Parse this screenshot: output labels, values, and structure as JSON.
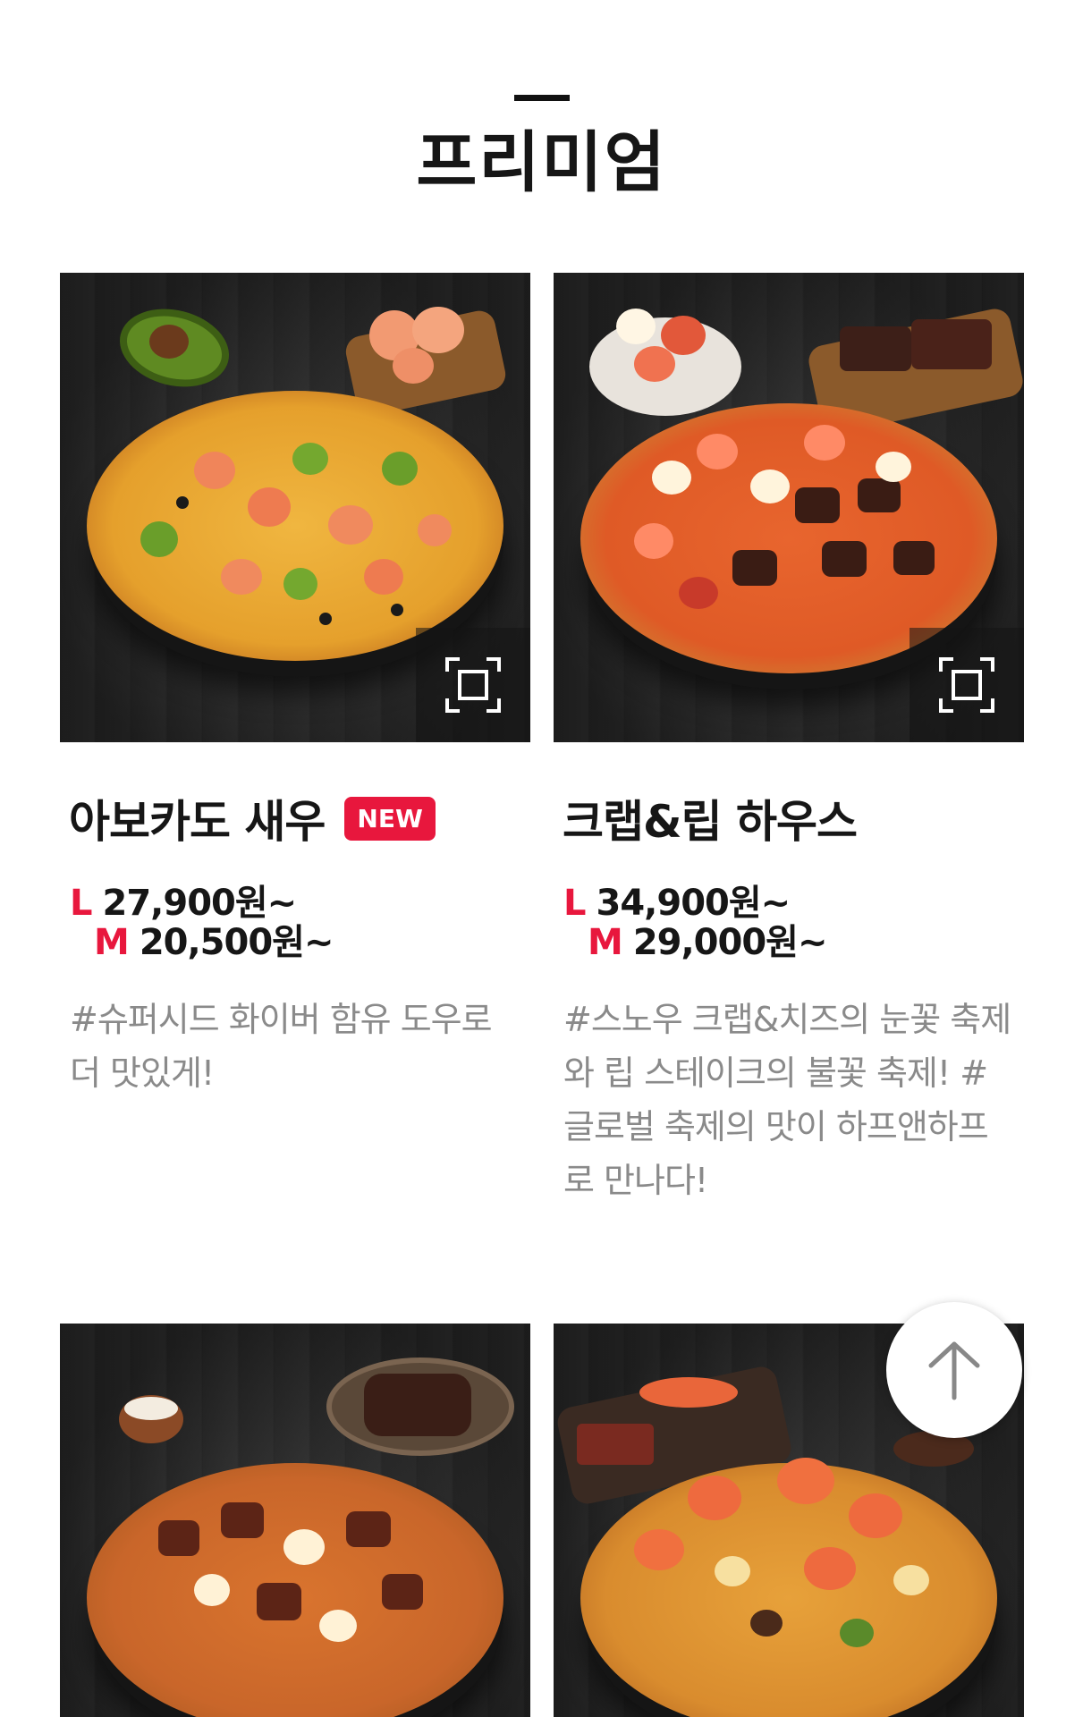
{
  "section": {
    "title": "프리미엄"
  },
  "products": [
    {
      "name": "아보카도 새우",
      "badge": "NEW",
      "price_l_size": "L",
      "price_l": "27,900원~",
      "price_m_size": "M",
      "price_m": "20,500원~",
      "description": "#슈퍼시드 화이버 함유 도우로 더 맛있게!",
      "image_icon": "pizza-avocado-shrimp-image"
    },
    {
      "name": "크랩&립 하우스",
      "badge": "",
      "price_l_size": "L",
      "price_l": "34,900원~",
      "price_m_size": "M",
      "price_m": "29,000원~",
      "description": "#스노우 크랩&치즈의 눈꽃 축제와 립 스테이크의 불꽃 축제! #글로벌 축제의 맛이 하프앤하프로 만나다!",
      "image_icon": "pizza-crab-rib-image"
    },
    {
      "image_icon": "pizza-steak-image"
    },
    {
      "image_icon": "pizza-shrimp-image"
    }
  ],
  "colors": {
    "accent": "#e8173d",
    "text": "#161616",
    "muted": "#8a8a8a"
  },
  "icons": {
    "zoom": "zoom-frame-icon",
    "scroll_top": "arrow-up-icon"
  }
}
